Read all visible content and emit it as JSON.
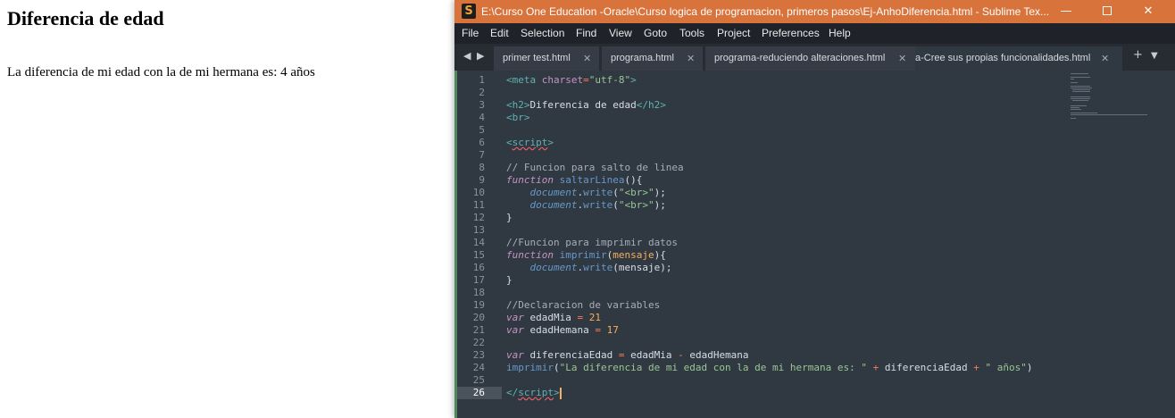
{
  "browser": {
    "heading": "Diferencia de edad",
    "output": "La diferencia de mi edad con la de mi hermana es: 4 años"
  },
  "window": {
    "title": "E:\\Curso One Education -Oracle\\Curso logica de programacion, primeros pasos\\Ej-AnhoDiferencia.html - Sublime Tex...",
    "logo": "S",
    "controls": {
      "minimize": "—",
      "close": "✕"
    }
  },
  "menu": [
    "File",
    "Edit",
    "Selection",
    "Find",
    "View",
    "Goto",
    "Tools",
    "Project",
    "Preferences",
    "Help"
  ],
  "tabs": {
    "nav_left": "◀",
    "nav_right": "▶",
    "items": [
      {
        "label": "primer test.html",
        "close": "✕"
      },
      {
        "label": "programa.html",
        "close": "✕"
      },
      {
        "label": "programa-reduciendo alteraciones.html",
        "close": "✕"
      },
      {
        "label": "a-Cree sus propias funcionalidades.html",
        "close": "✕"
      }
    ],
    "add": "+",
    "more": "▼"
  },
  "editor": {
    "current_line": 26,
    "line_numbers": [
      "1",
      "2",
      "3",
      "4",
      "5",
      "6",
      "7",
      "8",
      "9",
      "10",
      "11",
      "12",
      "13",
      "14",
      "15",
      "16",
      "17",
      "18",
      "19",
      "20",
      "21",
      "22",
      "23",
      "24",
      "25",
      "26"
    ],
    "lines": [
      [
        [
          "t-tag",
          "<meta "
        ],
        [
          "t-attr",
          "charset"
        ],
        [
          "t-op",
          "="
        ],
        [
          "t-str",
          "\"utf-8\""
        ],
        [
          "t-tag",
          ">"
        ]
      ],
      [],
      [
        [
          "t-tag",
          "<h2>"
        ],
        [
          "t-var",
          "Diferencia de edad"
        ],
        [
          "t-tag",
          "</h2>"
        ]
      ],
      [
        [
          "t-tag",
          "<br>"
        ]
      ],
      [],
      [
        [
          "t-tag",
          "<"
        ],
        [
          "t-tag squig",
          "script"
        ],
        [
          "t-tag",
          ">"
        ]
      ],
      [],
      [
        [
          "t-cmt",
          "// Funcion para salto de linea"
        ]
      ],
      [
        [
          "t-kw",
          "function "
        ],
        [
          "t-fn",
          "saltarLinea"
        ],
        [
          "t-var",
          "(){"
        ]
      ],
      [
        [
          "t-var",
          "    "
        ],
        [
          "t-obj",
          "document"
        ],
        [
          "t-var",
          "."
        ],
        [
          "t-fn",
          "write"
        ],
        [
          "t-var",
          "("
        ],
        [
          "t-str",
          "\"<br>\""
        ],
        [
          "t-var",
          ");"
        ]
      ],
      [
        [
          "t-var",
          "    "
        ],
        [
          "t-obj",
          "document"
        ],
        [
          "t-var",
          "."
        ],
        [
          "t-fn",
          "write"
        ],
        [
          "t-var",
          "("
        ],
        [
          "t-str",
          "\"<br>\""
        ],
        [
          "t-var",
          ");"
        ]
      ],
      [
        [
          "t-var",
          "}"
        ]
      ],
      [],
      [
        [
          "t-cmt",
          "//Funcion para imprimir datos"
        ]
      ],
      [
        [
          "t-kw",
          "function "
        ],
        [
          "t-fn",
          "imprimir"
        ],
        [
          "t-var",
          "("
        ],
        [
          "t-par",
          "mensaje"
        ],
        [
          "t-var",
          "){"
        ]
      ],
      [
        [
          "t-var",
          "    "
        ],
        [
          "t-obj",
          "document"
        ],
        [
          "t-var",
          "."
        ],
        [
          "t-fn",
          "write"
        ],
        [
          "t-var",
          "(mensaje);"
        ]
      ],
      [
        [
          "t-var",
          "}"
        ]
      ],
      [],
      [
        [
          "t-cmt",
          "//Declaracion de variables"
        ]
      ],
      [
        [
          "t-kw",
          "var "
        ],
        [
          "t-var",
          "edadMia "
        ],
        [
          "t-op",
          "= "
        ],
        [
          "t-num",
          "21"
        ]
      ],
      [
        [
          "t-kw",
          "var "
        ],
        [
          "t-var",
          "edadHemana "
        ],
        [
          "t-op",
          "= "
        ],
        [
          "t-num",
          "17"
        ]
      ],
      [],
      [
        [
          "t-kw",
          "var "
        ],
        [
          "t-var",
          "diferenciaEdad "
        ],
        [
          "t-op",
          "= "
        ],
        [
          "t-var",
          "edadMia "
        ],
        [
          "t-op",
          "- "
        ],
        [
          "t-var",
          "edadHemana"
        ]
      ],
      [
        [
          "t-fn",
          "imprimir"
        ],
        [
          "t-var",
          "("
        ],
        [
          "t-str",
          "\"La diferencia de mi edad con la de mi hermana es: \""
        ],
        [
          "t-op",
          " + "
        ],
        [
          "t-var",
          "diferenciaEdad"
        ],
        [
          "t-op",
          " + "
        ],
        [
          "t-str",
          "\" años\""
        ],
        [
          "t-var",
          ")"
        ]
      ],
      [],
      [
        [
          "t-tag",
          "</"
        ],
        [
          "t-tag squig",
          "script"
        ],
        [
          "t-tag",
          ">"
        ]
      ]
    ]
  }
}
